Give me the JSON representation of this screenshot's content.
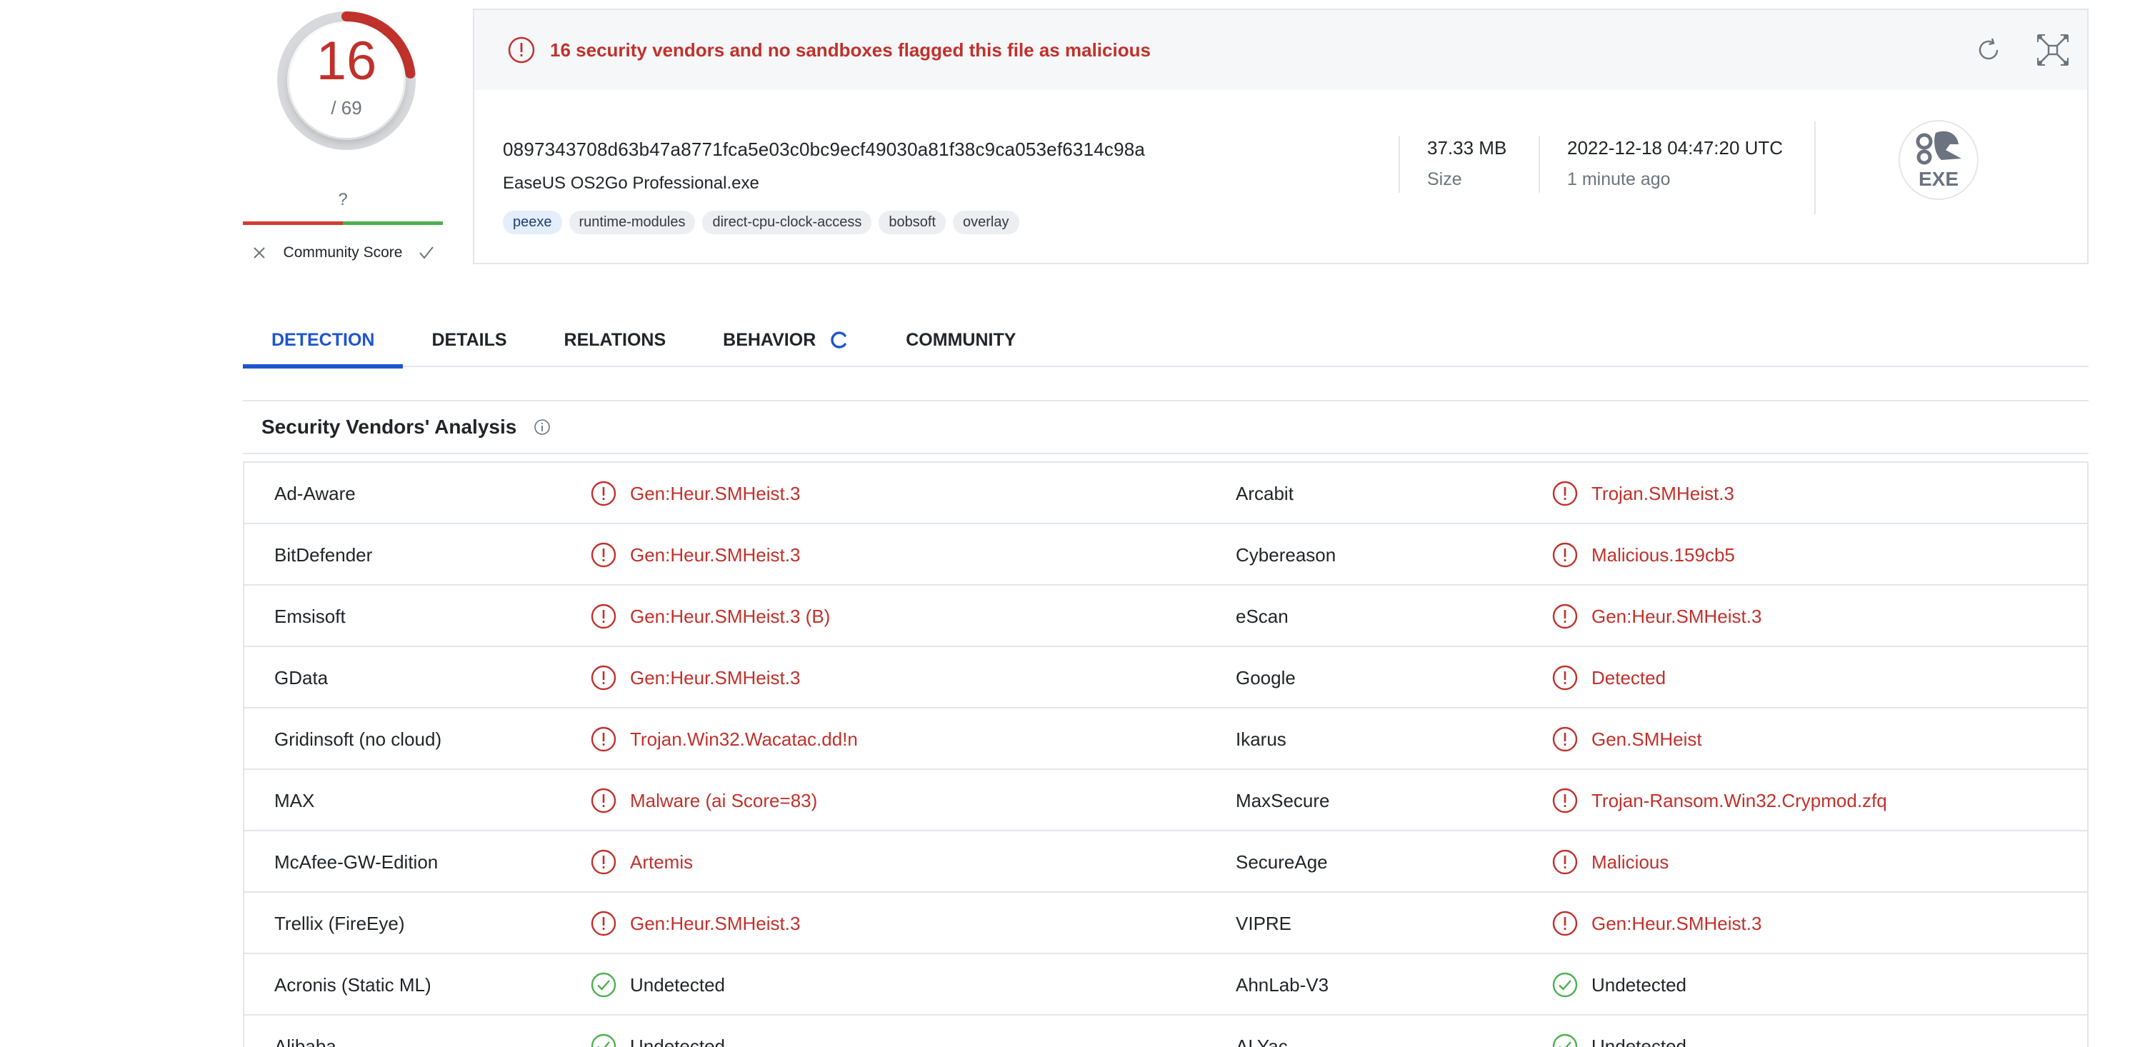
{
  "score": {
    "detections": "16",
    "total": "/ 69",
    "fraction_flagged": 0.232
  },
  "community": {
    "question": "?",
    "label": "Community Score"
  },
  "alert": {
    "text": "16 security vendors and no sandboxes flagged this file as malicious"
  },
  "file": {
    "hash": "0897343708d63b47a8771fca5e03c0bc9ecf49030a81f38c9ca053ef6314c98a",
    "name": "EaseUS OS2Go Professional.exe",
    "tags": [
      "peexe",
      "runtime-modules",
      "direct-cpu-clock-access",
      "bobsoft",
      "overlay"
    ],
    "size_value": "37.33 MB",
    "size_label": "Size",
    "date_value": "2022-12-18 04:47:20 UTC",
    "date_ago": "1 minute ago",
    "type_label": "EXE"
  },
  "tabs": [
    {
      "label": "DETECTION",
      "active": true
    },
    {
      "label": "DETAILS",
      "active": false
    },
    {
      "label": "RELATIONS",
      "active": false
    },
    {
      "label": "BEHAVIOR",
      "active": false
    },
    {
      "label": "COMMUNITY",
      "active": false
    }
  ],
  "section": {
    "title": "Security Vendors' Analysis"
  },
  "vendors": [
    {
      "left_name": "Ad-Aware",
      "left_result": "Gen:Heur.SMHeist.3",
      "left_status": "malicious",
      "right_name": "Arcabit",
      "right_result": "Trojan.SMHeist.3",
      "right_status": "malicious"
    },
    {
      "left_name": "BitDefender",
      "left_result": "Gen:Heur.SMHeist.3",
      "left_status": "malicious",
      "right_name": "Cybereason",
      "right_result": "Malicious.159cb5",
      "right_status": "malicious"
    },
    {
      "left_name": "Emsisoft",
      "left_result": "Gen:Heur.SMHeist.3 (B)",
      "left_status": "malicious",
      "right_name": "eScan",
      "right_result": "Gen:Heur.SMHeist.3",
      "right_status": "malicious"
    },
    {
      "left_name": "GData",
      "left_result": "Gen:Heur.SMHeist.3",
      "left_status": "malicious",
      "right_name": "Google",
      "right_result": "Detected",
      "right_status": "malicious"
    },
    {
      "left_name": "Gridinsoft (no cloud)",
      "left_result": "Trojan.Win32.Wacatac.dd!n",
      "left_status": "malicious",
      "right_name": "Ikarus",
      "right_result": "Gen.SMHeist",
      "right_status": "malicious"
    },
    {
      "left_name": "MAX",
      "left_result": "Malware (ai Score=83)",
      "left_status": "malicious",
      "right_name": "MaxSecure",
      "right_result": "Trojan-Ransom.Win32.Crypmod.zfq",
      "right_status": "malicious"
    },
    {
      "left_name": "McAfee-GW-Edition",
      "left_result": "Artemis",
      "left_status": "malicious",
      "right_name": "SecureAge",
      "right_result": "Malicious",
      "right_status": "malicious"
    },
    {
      "left_name": "Trellix (FireEye)",
      "left_result": "Gen:Heur.SMHeist.3",
      "left_status": "malicious",
      "right_name": "VIPRE",
      "right_result": "Gen:Heur.SMHeist.3",
      "right_status": "malicious"
    },
    {
      "left_name": "Acronis (Static ML)",
      "left_result": "Undetected",
      "left_status": "undetected",
      "right_name": "AhnLab-V3",
      "right_result": "Undetected",
      "right_status": "undetected"
    },
    {
      "left_name": "Alibaba",
      "left_result": "Undetected",
      "left_status": "undetected",
      "right_name": "ALYac",
      "right_result": "Undetected",
      "right_status": "undetected"
    }
  ],
  "colors": {
    "malicious": "#c0312b",
    "undetected_icon": "#4caf50",
    "accent": "#1d55cf"
  }
}
